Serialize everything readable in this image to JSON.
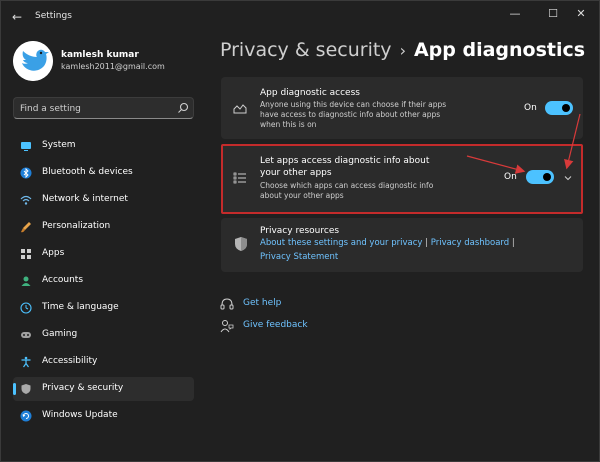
{
  "window": {
    "title": "Settings",
    "back_icon": "arrow-left-icon",
    "controls": {
      "minimize": "—",
      "maximize": "☐",
      "close": "✕"
    }
  },
  "profile": {
    "name": "kamlesh kumar",
    "email": "kamlesh2011@gmail.com",
    "avatar_icon": "twitter-bird-icon"
  },
  "search": {
    "placeholder": "Find a setting",
    "icon": "search-icon"
  },
  "sidebar": {
    "items": [
      {
        "label": "System",
        "icon": "monitor-icon",
        "active": false
      },
      {
        "label": "Bluetooth & devices",
        "icon": "bluetooth-icon",
        "active": false
      },
      {
        "label": "Network & internet",
        "icon": "wifi-icon",
        "active": false
      },
      {
        "label": "Personalization",
        "icon": "brush-icon",
        "active": false
      },
      {
        "label": "Apps",
        "icon": "apps-icon",
        "active": false
      },
      {
        "label": "Accounts",
        "icon": "person-icon",
        "active": false
      },
      {
        "label": "Time & language",
        "icon": "globe-clock-icon",
        "active": false
      },
      {
        "label": "Gaming",
        "icon": "gamepad-icon",
        "active": false
      },
      {
        "label": "Accessibility",
        "icon": "accessibility-icon",
        "active": false
      },
      {
        "label": "Privacy & security",
        "icon": "shield-icon",
        "active": true
      },
      {
        "label": "Windows Update",
        "icon": "update-icon",
        "active": false
      }
    ]
  },
  "breadcrumb": {
    "parent": "Privacy & security",
    "separator": "›",
    "current": "App diagnostics"
  },
  "settings": {
    "app_diagnostic_access": {
      "title": "App diagnostic access",
      "description_lines": [
        "Anyone using this device can choose if their apps",
        "have access to diagnostic info about other apps",
        "when this is on"
      ],
      "toggle_state": "On",
      "icon": "chart-area-icon"
    },
    "let_apps_access": {
      "title_lines": [
        "Let apps access diagnostic info about",
        "your other apps"
      ],
      "description_lines": [
        "Choose which apps can access diagnostic info",
        "about your other apps"
      ],
      "toggle_state": "On",
      "icon": "list-icon",
      "expand_icon": "chevron-down-icon"
    }
  },
  "privacy_resources": {
    "title": "Privacy resources",
    "icon": "shield-icon",
    "links": {
      "about": "About these settings and your privacy",
      "dashboard": "Privacy dashboard",
      "statement": "Privacy Statement"
    },
    "separator": "|"
  },
  "footer": {
    "get_help": "Get help",
    "give_feedback": "Give feedback",
    "help_icon": "help-headset-icon",
    "feedback_icon": "feedback-person-icon"
  },
  "colors": {
    "background": "#202020",
    "card": "#2b2b2b",
    "accent": "#4cc2ff",
    "link": "#6fc3ff",
    "annotation_red": "#c42b2b"
  }
}
